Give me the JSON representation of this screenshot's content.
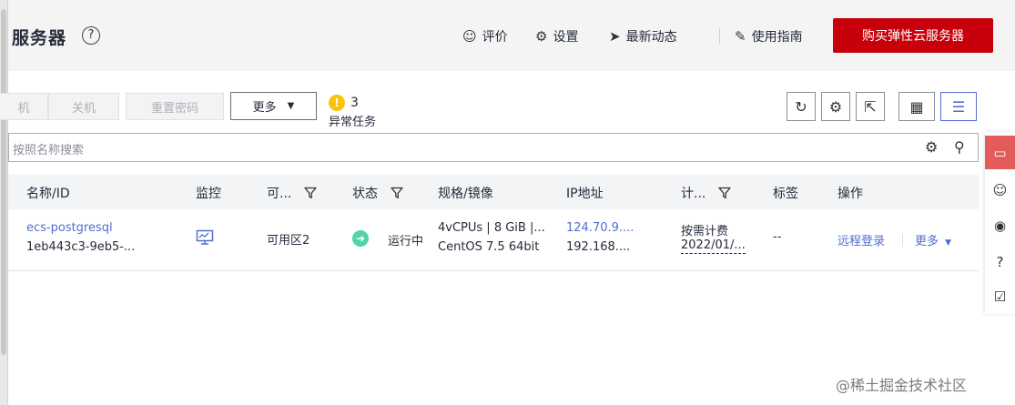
{
  "header": {
    "title": "服务器",
    "help_symbol": "?",
    "links": [
      {
        "label": "评价",
        "icon": "smile-icon"
      },
      {
        "label": "设置",
        "icon": "gear-icon"
      },
      {
        "label": "最新动态",
        "icon": "send-icon"
      },
      {
        "label": "使用指南",
        "icon": "edit-doc-icon"
      }
    ],
    "buy_button": "购买弹性云服务器"
  },
  "toolbar": {
    "buttons": {
      "boot": "机",
      "shutdown": "关机",
      "reset_password": "重置密码",
      "more": "更多"
    },
    "abnormal_tasks": {
      "count": "3",
      "label": "异常任务"
    }
  },
  "search": {
    "placeholder": "按照名称搜索"
  },
  "table": {
    "columns": [
      "名称/ID",
      "监控",
      "可...",
      "状态",
      "规格/镜像",
      "IP地址",
      "计...",
      "标签",
      "操作"
    ],
    "rows": [
      {
        "name": "ecs-postgresql",
        "id": "1eb443c3-9eb5-...",
        "zone": "可用区2",
        "status": "运行中",
        "spec": "4vCPUs | 8 GiB |...",
        "image": "CentOS 7.5 64bit",
        "ip_public": "124.70.9....",
        "ip_private": "192.168....",
        "billing": "按需计费",
        "billing_date": "2022/01/...",
        "tag": "--",
        "op_login": "远程登录",
        "op_more": "更多"
      }
    ]
  },
  "colors": {
    "brand": "#c7000b",
    "link": "#526ecc",
    "running": "#50d4ab",
    "warning": "#fac20a"
  },
  "watermark": "@稀土掘金技术社区"
}
